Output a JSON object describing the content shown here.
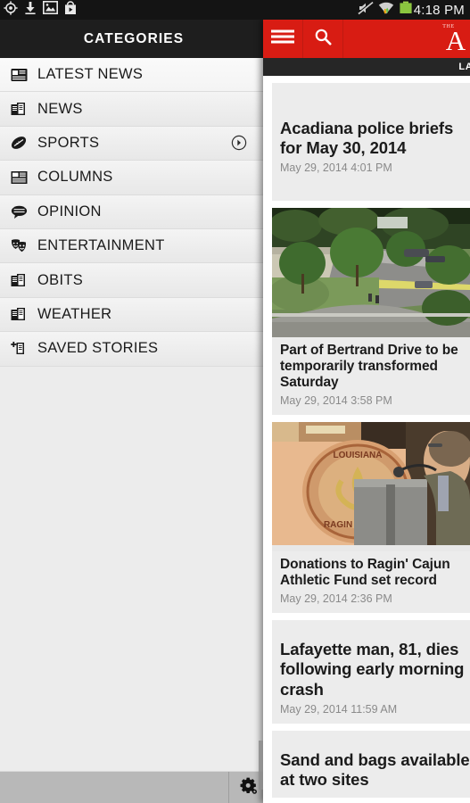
{
  "status_bar": {
    "time": "4:18 PM",
    "left_icons": [
      "gps-icon",
      "download-icon",
      "image-icon",
      "play-store-icon"
    ],
    "right_icons": [
      "mute-icon",
      "wifi-icon",
      "battery-icon"
    ]
  },
  "drawer": {
    "title": "CATEGORIES",
    "items": [
      {
        "label": "LATEST NEWS",
        "icon": "newspaper-icon",
        "has_submenu": false
      },
      {
        "label": "NEWS",
        "icon": "documents-icon",
        "has_submenu": false
      },
      {
        "label": "SPORTS",
        "icon": "football-icon",
        "has_submenu": true
      },
      {
        "label": "COLUMNS",
        "icon": "columns-icon",
        "has_submenu": false
      },
      {
        "label": "OPINION",
        "icon": "speech-bubble-icon",
        "has_submenu": false
      },
      {
        "label": "ENTERTAINMENT",
        "icon": "theater-masks-icon",
        "has_submenu": false
      },
      {
        "label": "OBITS",
        "icon": "documents-icon",
        "has_submenu": false
      },
      {
        "label": "WEATHER",
        "icon": "documents-icon",
        "has_submenu": false
      },
      {
        "label": "SAVED STORIES",
        "icon": "save-document-icon",
        "has_submenu": false
      }
    ],
    "bottom_bar": {
      "settings_icon": "gear-icon"
    }
  },
  "app_bar": {
    "menu_icon": "hamburger-menu-icon",
    "search_icon": "search-icon",
    "brand_the": "THE",
    "brand_initial": "A",
    "accent_color": "#d81c13"
  },
  "section_bar": {
    "label": "LATEST NEWS"
  },
  "feed": {
    "articles": [
      {
        "title": "Acadiana police briefs for May 30, 2014",
        "date": "May 29, 2014 4:01 PM",
        "has_image": false,
        "image_alt": ""
      },
      {
        "title": "Part of Bertrand Drive to be temporarily transformed Saturday",
        "date": "May 29, 2014 3:58 PM",
        "has_image": true,
        "image_alt": "aerial-view-of-tree-lined-road"
      },
      {
        "title": "Donations to Ragin' Cajun Athletic Fund set record",
        "date": "May 29, 2014 2:36 PM",
        "has_image": true,
        "image_alt": "man-at-podium-with-ragin-cajuns-logo"
      },
      {
        "title": "Lafayette man, 81, dies following early morning crash",
        "date": "May 29, 2014 11:59 AM",
        "has_image": false,
        "image_alt": ""
      },
      {
        "title": "Sand and bags available at two sites",
        "date": "",
        "has_image": false,
        "image_alt": ""
      }
    ]
  }
}
